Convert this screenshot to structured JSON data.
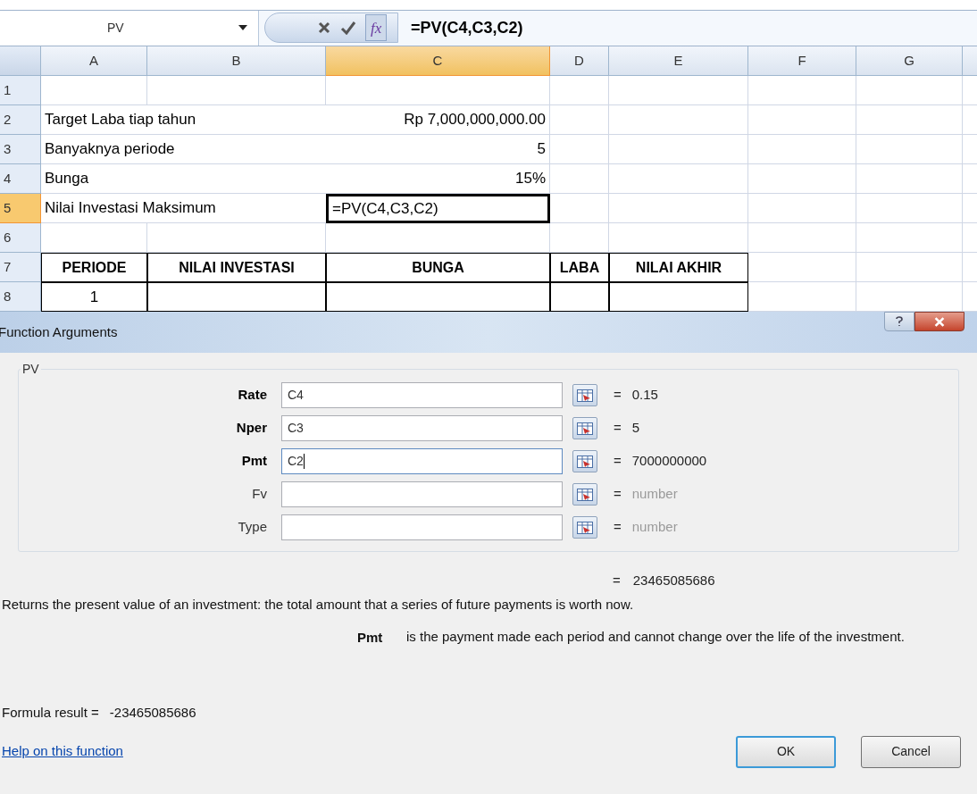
{
  "formula_bar": {
    "name_box": "PV",
    "function_button": "fx",
    "formula": "=PV(C4,C3,C2)"
  },
  "columns": [
    {
      "label": "A",
      "selected": false
    },
    {
      "label": "B",
      "selected": false
    },
    {
      "label": "C",
      "selected": true
    },
    {
      "label": "D",
      "selected": false
    },
    {
      "label": "E",
      "selected": false
    },
    {
      "label": "F",
      "selected": false
    },
    {
      "label": "G",
      "selected": false
    }
  ],
  "rows": [
    {
      "number": "1",
      "selected": false,
      "cells": [
        null,
        null,
        null,
        null,
        null,
        null,
        null
      ]
    },
    {
      "number": "2",
      "selected": false,
      "cells": [
        {
          "text": "Target Laba tiap tahun",
          "kind": "text"
        },
        null,
        {
          "text": "Rp 7,000,000,000.00",
          "kind": "number"
        },
        null,
        null,
        null,
        null
      ]
    },
    {
      "number": "3",
      "selected": false,
      "cells": [
        {
          "text": "Banyaknya periode",
          "kind": "text"
        },
        null,
        {
          "text": "5",
          "kind": "number"
        },
        null,
        null,
        null,
        null
      ]
    },
    {
      "number": "4",
      "selected": false,
      "cells": [
        {
          "text": "Bunga",
          "kind": "text"
        },
        null,
        {
          "text": "15%",
          "kind": "number"
        },
        null,
        null,
        null,
        null
      ]
    },
    {
      "number": "5",
      "selected": true,
      "cells": [
        {
          "text": "Nilai Investasi Maksimum",
          "kind": "text"
        },
        null,
        {
          "text": "=PV(C4,C3,C2)",
          "kind": "editing"
        },
        null,
        null,
        null,
        null
      ]
    },
    {
      "number": "6",
      "selected": false,
      "cells": [
        null,
        null,
        null,
        null,
        null,
        null,
        null
      ]
    },
    {
      "number": "7",
      "selected": false,
      "cells": [
        {
          "text": "PERIODE",
          "kind": "heading"
        },
        {
          "text": "NILAI INVESTASI",
          "kind": "heading"
        },
        {
          "text": "BUNGA",
          "kind": "heading"
        },
        {
          "text": "LABA",
          "kind": "heading"
        },
        {
          "text": "NILAI AKHIR",
          "kind": "heading"
        },
        null,
        null
      ]
    },
    {
      "number": "8",
      "selected": false,
      "cells": [
        {
          "text": "1",
          "kind": "centered"
        },
        {
          "kind": "blank"
        },
        {
          "kind": "blank"
        },
        {
          "kind": "blank"
        },
        {
          "kind": "blank"
        },
        null,
        null
      ]
    }
  ],
  "dialog": {
    "title": "Function Arguments",
    "group_label": "PV",
    "arguments": [
      {
        "label": "Rate",
        "bold": true,
        "value": "C4",
        "focused": false,
        "equals": "=",
        "result": "0.15",
        "dim": false
      },
      {
        "label": "Nper",
        "bold": true,
        "value": "C3",
        "focused": false,
        "equals": "=",
        "result": "5",
        "dim": false
      },
      {
        "label": "Pmt",
        "bold": true,
        "value": "C2",
        "focused": true,
        "equals": "=",
        "result": "7000000000",
        "dim": false
      },
      {
        "label": "Fv",
        "bold": false,
        "equals": "=",
        "result": "number",
        "dim": true
      },
      {
        "label": "Type",
        "bold": false,
        "equals": "=",
        "result": "number",
        "dim": true
      }
    ],
    "total": {
      "equals": "=",
      "value": "23465085686"
    },
    "description": "Returns the present value of an investment: the total amount that a series of future payments is worth now.",
    "argument_help": {
      "name": "Pmt",
      "text": "is the payment made each period and cannot change over the life of the investment."
    },
    "formula_result": {
      "label": "Formula result =",
      "value": "-23465085686"
    },
    "help_link": "Help on this function",
    "buttons": [
      {
        "label": "OK",
        "default": true
      },
      {
        "label": "Cancel",
        "default": false
      }
    ]
  }
}
